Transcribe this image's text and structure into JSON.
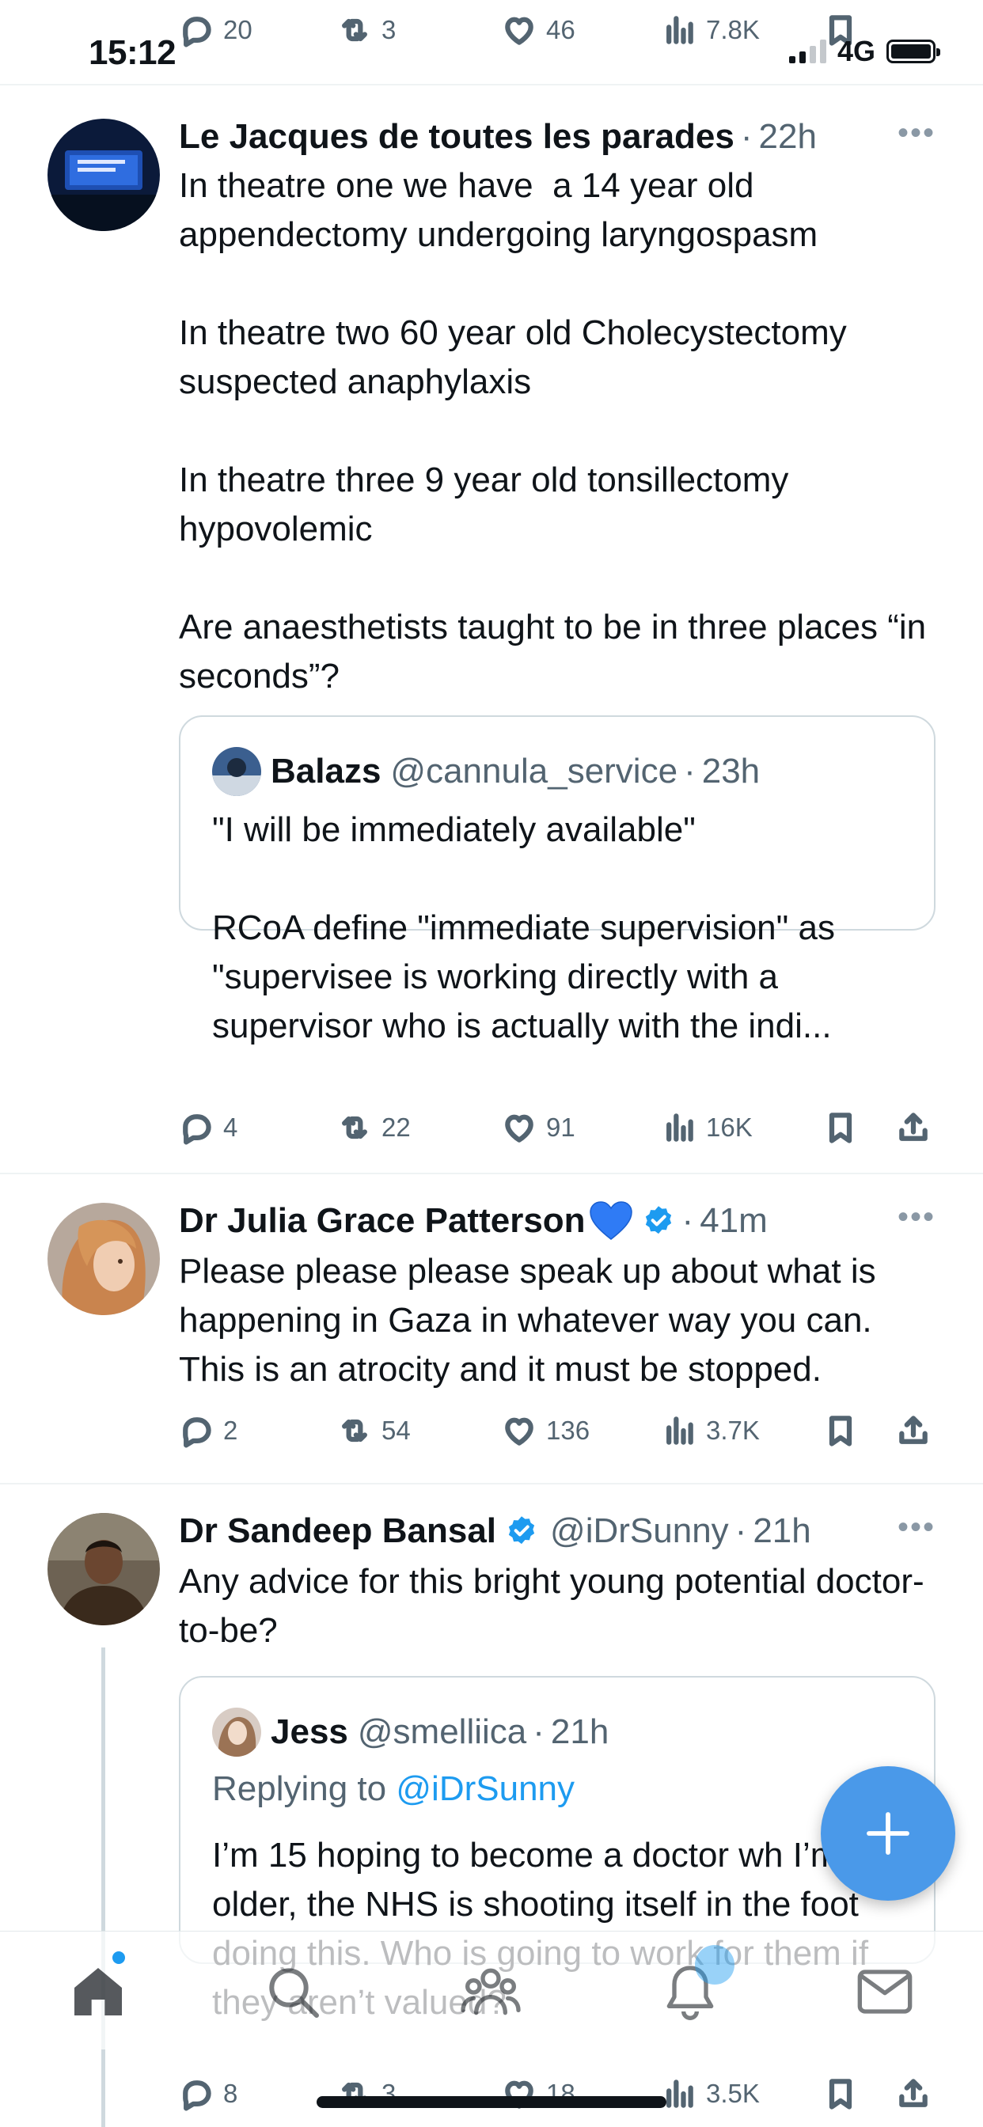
{
  "status_bar": {
    "time": "15:12",
    "network": "4G"
  },
  "top_actions": {
    "replies": "20",
    "retweets": "3",
    "likes": "46",
    "views": "7.8K"
  },
  "tweets": [
    {
      "name": "Le Jacques de toutes les parades",
      "handle": "",
      "time": "22h",
      "text": "In theatre one we have  a 14 year old appendectomy undergoing laryngospasm\n\nIn theatre two 60 year old Cholecystectomy suspected anaphylaxis\n\nIn theatre three 9 year old tonsillectomy hypovolemic\n\nAre anaesthetists taught to be in three places “in seconds”?",
      "quote": {
        "name": "Balazs",
        "handle": "@cannula_service",
        "time": "23h",
        "text": "\"I will be immediately available\"\n\nRCoA define \"immediate supervision\" as \"supervisee is working directly with a supervisor who is actually with the indi..."
      },
      "replies": "4",
      "retweets": "22",
      "likes": "91",
      "views": "16K"
    },
    {
      "name": "Dr Julia Grace Patterson",
      "time": "41m",
      "text": "Please please please speak up about what is happening in Gaza in whatever way you can. This is an atrocity and it must be stopped.",
      "replies": "2",
      "retweets": "54",
      "likes": "136",
      "views": "3.7K"
    },
    {
      "name": "Dr Sandeep Bansal",
      "handle": "@iDrSunny",
      "time": "21h",
      "text": "Any advice for this bright young potential doctor-to-be?",
      "quote": {
        "name": "Jess",
        "handle": "@smelliica",
        "time": "21h",
        "replying_prefix": "Replying to",
        "replying_to": "@iDrSunny",
        "text": "I’m 15 hoping to become a doctor wh I’m older, the NHS is shooting itself in the foot doing this. Who is going to work for them if they aren’t valued?"
      },
      "replies": "8",
      "retweets": "3",
      "likes": "18",
      "views": "3.5K"
    }
  ],
  "icons": {
    "reply": "reply-icon",
    "retweet": "retweet-icon",
    "like": "heart-icon",
    "views": "views-icon",
    "bookmark": "bookmark-icon",
    "share": "share-icon",
    "compose": "plus-icon",
    "nav": [
      "home-icon",
      "search-icon",
      "communities-icon",
      "notifications-icon",
      "messages-icon"
    ]
  },
  "colors": {
    "accent": "#1d9bf0",
    "fab": "#4a99e9",
    "muted_text": "#536471",
    "border": "#cfd9de"
  }
}
